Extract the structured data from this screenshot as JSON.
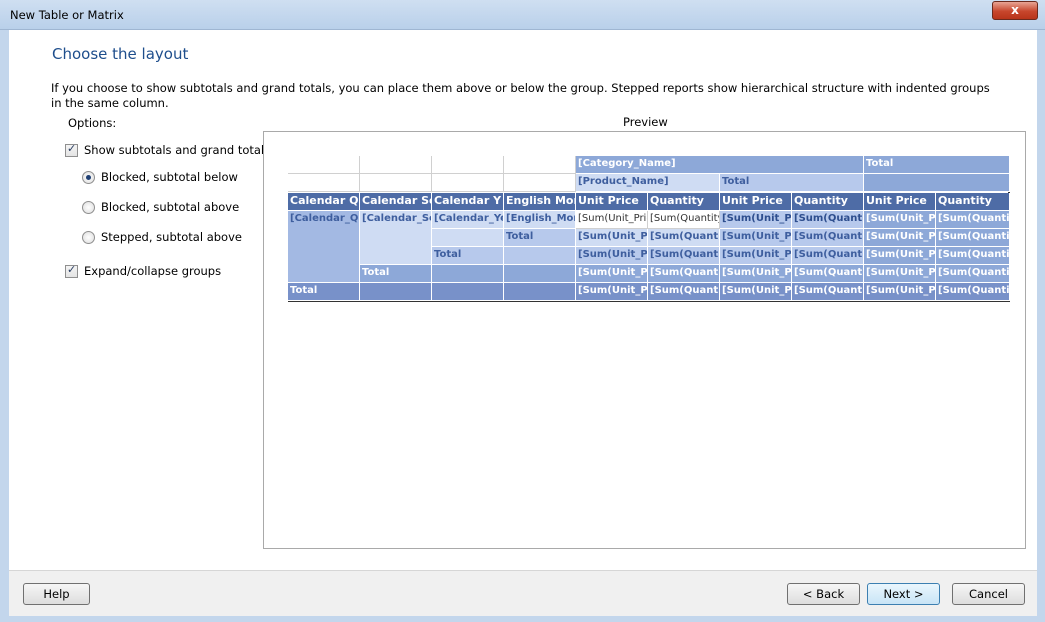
{
  "window": {
    "title": "New Table or Matrix",
    "close_label": "x"
  },
  "page": {
    "title": "Choose the layout",
    "description": "If you choose to show subtotals and grand totals, you can place them above or below the group. Stepped reports show hierarchical structure with indented groups in the same column."
  },
  "options": {
    "label": "Options:",
    "show_subtotals": {
      "label": "Show subtotals and grand totals",
      "checked": true
    },
    "radios": [
      {
        "label": "Blocked, subtotal below",
        "checked": true
      },
      {
        "label": "Blocked, subtotal above",
        "checked": false
      },
      {
        "label": "Stepped, subtotal above",
        "checked": false
      }
    ],
    "expand_collapse": {
      "label": "Expand/collapse groups",
      "checked": true
    }
  },
  "preview": {
    "label": "Preview",
    "category_name": "[Category_Name]",
    "product_name": "[Product_Name]",
    "total": "Total",
    "headers": [
      "Calendar Q",
      "Calendar Se",
      "Calendar Y",
      "English Mon",
      "Unit Price",
      "Quantity",
      "Unit Price",
      "Quantity",
      "Unit Price",
      "Quantity"
    ],
    "row_groups": [
      "[Calendar_Qu",
      "[Calendar_Ser",
      "[Calendar_Yea",
      "[English_Mont"
    ],
    "sum_unit_price_full": "[Sum(Unit_Price",
    "sum_quantity_full": "[Sum(Quantity)",
    "sum_unit_price": "[Sum(Unit_Pri",
    "sum_quantity": "[Sum(Quantit"
  },
  "footer": {
    "help": "Help",
    "back": "< Back",
    "next": "Next >",
    "cancel": "Cancel"
  }
}
